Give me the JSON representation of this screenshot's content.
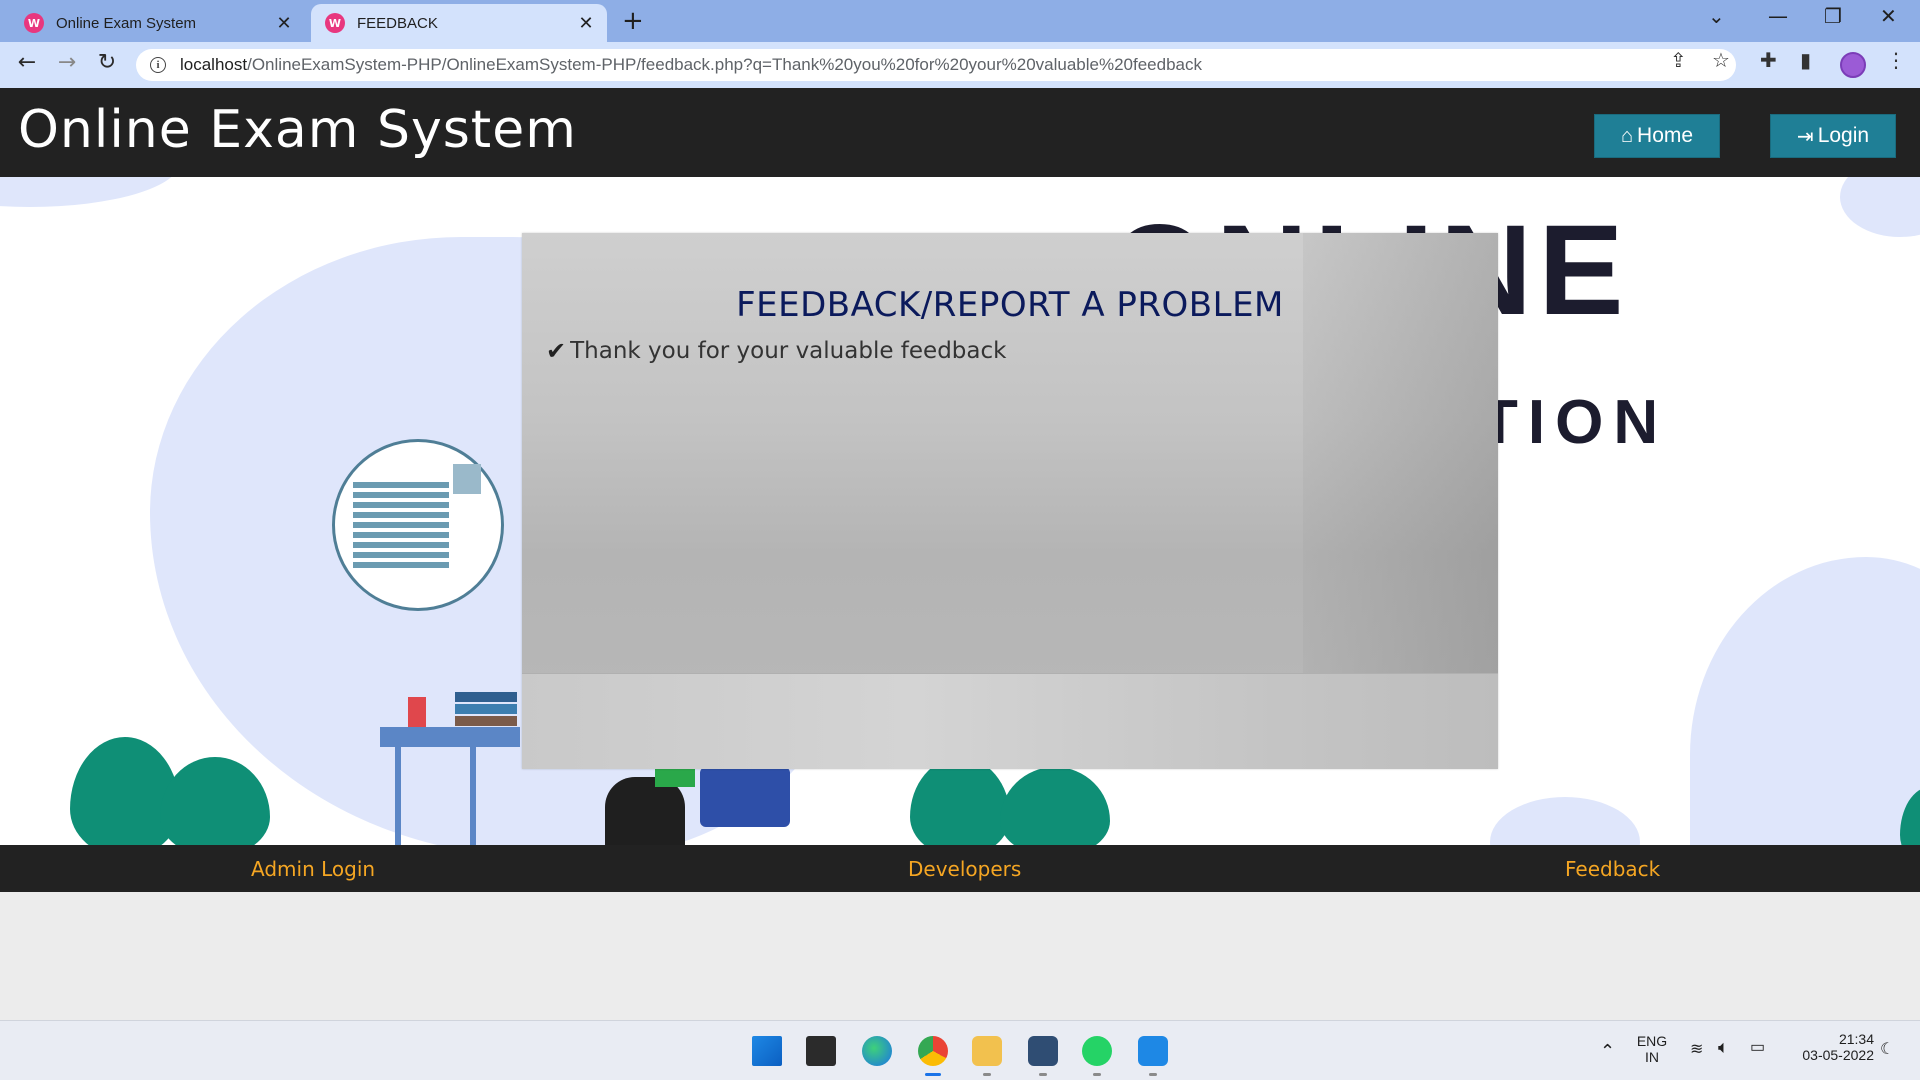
{
  "browser": {
    "tabs": [
      {
        "title": "Online Exam System",
        "active": false
      },
      {
        "title": "FEEDBACK",
        "active": true
      }
    ],
    "url_host": "localhost",
    "url_path": "/OnlineExamSystem-PHP/OnlineExamSystem-PHP/feedback.php?q=Thank%20you%20for%20your%20valuable%20feedback"
  },
  "header": {
    "title": "Online Exam System",
    "home_label": "Home",
    "login_label": "Login"
  },
  "hero": {
    "big_text": "ONLINE",
    "small_text": "TION"
  },
  "modal": {
    "title": "FEEDBACK/REPORT A PROBLEM",
    "message": "Thank you for your valuable feedback"
  },
  "footer": {
    "admin_login": "Admin Login",
    "developers": "Developers",
    "feedback": "Feedback"
  },
  "taskbar": {
    "lang": "ENG",
    "region": "IN",
    "time": "21:34",
    "date": "03-05-2022"
  },
  "colors": {
    "header_bg": "#222222",
    "button_bg": "#1f7f96",
    "footer_link": "#f5a623",
    "modal_title": "#0b1a5c"
  }
}
